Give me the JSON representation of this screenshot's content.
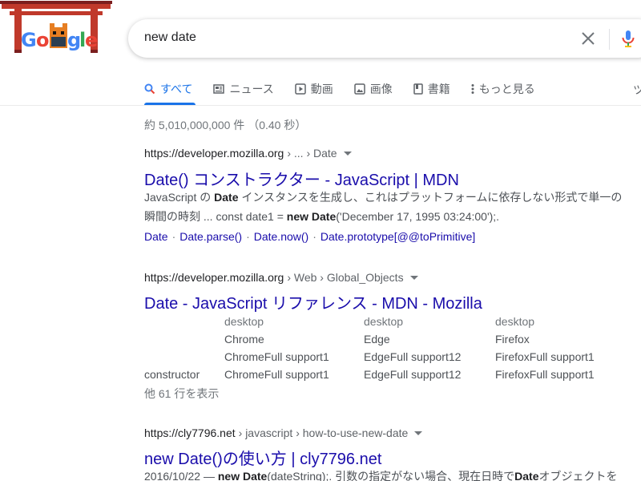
{
  "search": {
    "query": "new date"
  },
  "tabs": [
    {
      "label": "すべて",
      "icon": "search-icon",
      "active": true
    },
    {
      "label": "ニュース",
      "icon": "news-icon"
    },
    {
      "label": "動画",
      "icon": "video-icon"
    },
    {
      "label": "画像",
      "icon": "image-icon"
    },
    {
      "label": "書籍",
      "icon": "book-icon"
    },
    {
      "label": "もっと見る",
      "icon": "more-vert-icon"
    }
  ],
  "tab_overflow": "ツ",
  "stats": "約 5,010,000,000 件 （0.40 秒）",
  "results": [
    {
      "url": "https://developer.mozilla.org",
      "breadcrumb": "› ... › Date",
      "title": "Date() コンストラクター - JavaScript | MDN",
      "snippet_line1": {
        "a": "JavaScript の ",
        "b": "Date",
        "c": " インスタンスを生成し、これはプラットフォームに依存しない形式で単一の"
      },
      "snippet_line2": {
        "a": "瞬間の時刻 ... const date1 = ",
        "b": "new Date",
        "c": "('December 17, 1995 03:24:00');."
      },
      "sitelinks": [
        "Date",
        "Date.parse()",
        "Date.now()",
        "Date.prototype[@@toPrimitive]"
      ]
    },
    {
      "url": "https://developer.mozilla.org",
      "breadcrumb": "› Web › Global_Objects",
      "title": "Date - JavaScript リファレンス - MDN - Mozilla",
      "table": {
        "headers": [
          "desktop",
          "desktop",
          "desktop"
        ],
        "browsers": [
          "Chrome",
          "Edge",
          "Firefox"
        ],
        "support_row": [
          "ChromeFull support1",
          "EdgeFull support12",
          "FirefoxFull support1"
        ],
        "constructor_row": {
          "label": "constructor",
          "values": [
            "ChromeFull support1",
            "EdgeFull support12",
            "FirefoxFull support1"
          ]
        }
      },
      "more_rows": "他 61 行を表示"
    },
    {
      "url": "https://cly7796.net",
      "breadcrumb": "› javascript › how-to-use-new-date",
      "title": "new Date()の使い方 | cly7796.net",
      "snippet_line1": {
        "a": "2016/10/22 — ",
        "b": "new Date",
        "c": "(dateString);. 引数の指定がない場合、現在日時で",
        "d": "Date",
        "e": "オブジェクトを"
      }
    }
  ]
}
